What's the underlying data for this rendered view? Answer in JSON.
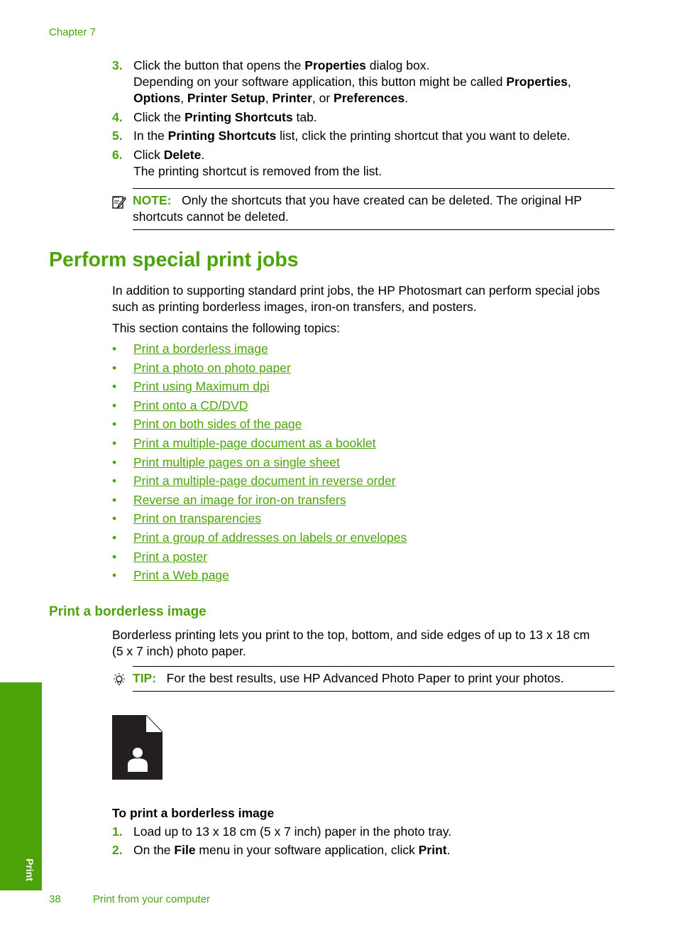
{
  "header": {
    "chapter": "Chapter 7"
  },
  "steps_top": [
    {
      "num": "3.",
      "parts": [
        "Click the button that opens the ",
        "Properties",
        " dialog box."
      ],
      "extra": [
        "Depending on your software application, this button might be called ",
        "Properties",
        ",",
        "Options",
        ", ",
        "Printer Setup",
        ", ",
        "Printer",
        ", or ",
        "Preferences",
        "."
      ]
    },
    {
      "num": "4.",
      "parts": [
        "Click the ",
        "Printing Shortcuts",
        " tab."
      ]
    },
    {
      "num": "5.",
      "parts": [
        "In the ",
        "Printing Shortcuts",
        " list, click the printing shortcut that you want to delete."
      ]
    },
    {
      "num": "6.",
      "parts": [
        "Click ",
        "Delete",
        "."
      ],
      "extra_plain": "The printing shortcut is removed from the list."
    }
  ],
  "note": {
    "icon": "note-pencil-icon",
    "label": "NOTE:",
    "text_line1": "Only the shortcuts that you have created can be deleted. The original HP",
    "text_line2": "shortcuts cannot be deleted."
  },
  "section": {
    "title": "Perform special print jobs",
    "intro_line1": "In addition to supporting standard print jobs, the HP Photosmart can perform special jobs",
    "intro_line2": "such as printing borderless images, iron-on transfers, and posters.",
    "topics_intro": "This section contains the following topics:",
    "bullet": "•",
    "topics": [
      "Print a borderless image",
      "Print a photo on photo paper",
      "Print using Maximum dpi",
      "Print onto a CD/DVD",
      "Print on both sides of the page",
      "Print a multiple-page document as a booklet",
      "Print multiple pages on a single sheet",
      "Print a multiple-page document in reverse order",
      "Reverse an image for iron-on transfers",
      "Print on transparencies",
      "Print a group of addresses on labels or envelopes",
      "Print a poster",
      "Print a Web page"
    ]
  },
  "subsection": {
    "title": "Print a borderless image",
    "desc_line1": "Borderless printing lets you print to the top, bottom, and side edges of up to 13 x 18 cm",
    "desc_line2": "(5 x 7 inch) photo paper.",
    "tip": {
      "icon": "lightbulb-icon",
      "label": "TIP:",
      "text": "For the best results, use HP Advanced Photo Paper to print your photos."
    },
    "image_icon": "borderless-photo-icon",
    "procedure_title": "To print a borderless image",
    "steps": [
      {
        "num": "1.",
        "parts": [
          "Load up to 13 x 18 cm (5 x 7 inch) paper in the photo tray."
        ]
      },
      {
        "num": "2.",
        "parts": [
          "On the ",
          "File",
          " menu in your software application, click ",
          "Print",
          "."
        ]
      }
    ]
  },
  "side_tab": {
    "label": "Print"
  },
  "footer": {
    "page_number": "38",
    "section_title": "Print from your computer"
  }
}
